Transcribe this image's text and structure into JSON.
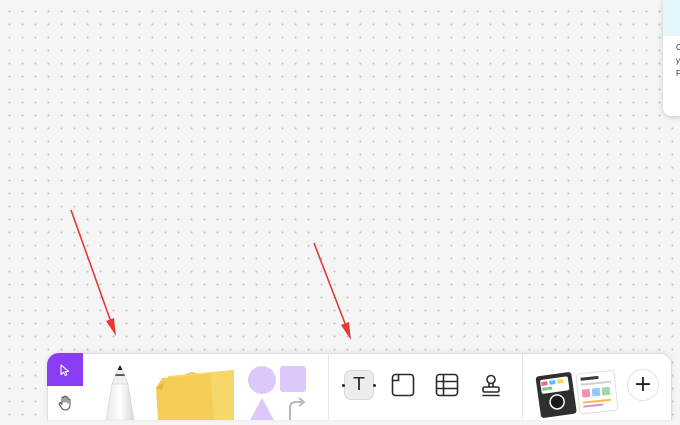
{
  "side_card": {
    "lines": [
      "C",
      "y",
      "F"
    ]
  },
  "colors": {
    "accent": "#8b3cf7",
    "arrow": "#e53935",
    "sticky_note": "#f6d769",
    "shape_fill": "#dcc8fb",
    "canvas_bg": "#f5f5f5"
  },
  "toolbar": {
    "modes": [
      {
        "name": "select",
        "icon": "cursor-arrow-icon",
        "active": true
      },
      {
        "name": "hand",
        "icon": "hand-icon",
        "active": false
      }
    ],
    "creation_tools": [
      {
        "name": "marker",
        "icon": "marker-pen-icon"
      },
      {
        "name": "sticky-note",
        "icon": "sticky-note-icon"
      },
      {
        "name": "shapes-connectors",
        "icon": "shapes-icon"
      }
    ],
    "secondary_tools": [
      {
        "name": "text",
        "icon": "text-icon",
        "label": "T",
        "active": true
      },
      {
        "name": "section",
        "icon": "section-icon",
        "active": false
      },
      {
        "name": "table",
        "icon": "table-icon",
        "active": false
      },
      {
        "name": "stamp",
        "icon": "stamp-icon",
        "active": false
      }
    ],
    "extras": [
      {
        "name": "templates",
        "icon": "templates-thumbnail-icon"
      },
      {
        "name": "more",
        "icon": "plus-icon",
        "label": "+"
      }
    ]
  }
}
